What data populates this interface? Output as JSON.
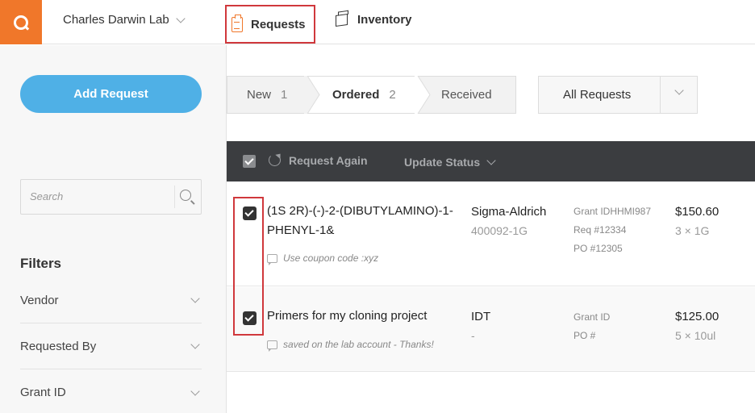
{
  "nav": {
    "lab_name": "Charles Darwin Lab",
    "requests_label": "Requests",
    "inventory_label": "Inventory"
  },
  "sidebar": {
    "add_request_label": "Add Request",
    "search_placeholder": "Search",
    "filters_title": "Filters",
    "filters": [
      {
        "label": "Vendor"
      },
      {
        "label": "Requested By"
      },
      {
        "label": "Grant ID"
      }
    ]
  },
  "status_tabs": [
    {
      "label": "New",
      "count": "1"
    },
    {
      "label": "Ordered",
      "count": "2"
    },
    {
      "label": "Received",
      "count": ""
    }
  ],
  "request_filter": {
    "value": "All Requests"
  },
  "toolbar": {
    "request_again_label": "Request Again",
    "update_status_label": "Update Status"
  },
  "requests": [
    {
      "name": "(1S 2R)-(-)-2-(DIBUTYLAMINO)-1-PHENYL-1&",
      "note": "Use coupon code :xyz",
      "vendor": "Sigma-Aldrich",
      "catalog": "400092-1G",
      "grant": "Grant IDHHMI987",
      "req": "Req #12334",
      "po": "PO #12305",
      "price": "$150.60",
      "qty": "3  ×  1G",
      "checked": true
    },
    {
      "name": "Primers for my cloning project",
      "note": "saved on the lab account - Thanks!",
      "vendor": "IDT",
      "catalog": "-",
      "grant": "Grant ID",
      "po": "PO #",
      "price": "$125.00",
      "qty": "5  ×  10ul",
      "checked": true
    }
  ],
  "colors": {
    "brand": "#f0772a",
    "accent": "#4fb0e6",
    "toolbar": "#3b3d40",
    "highlight": "#d0383c"
  }
}
